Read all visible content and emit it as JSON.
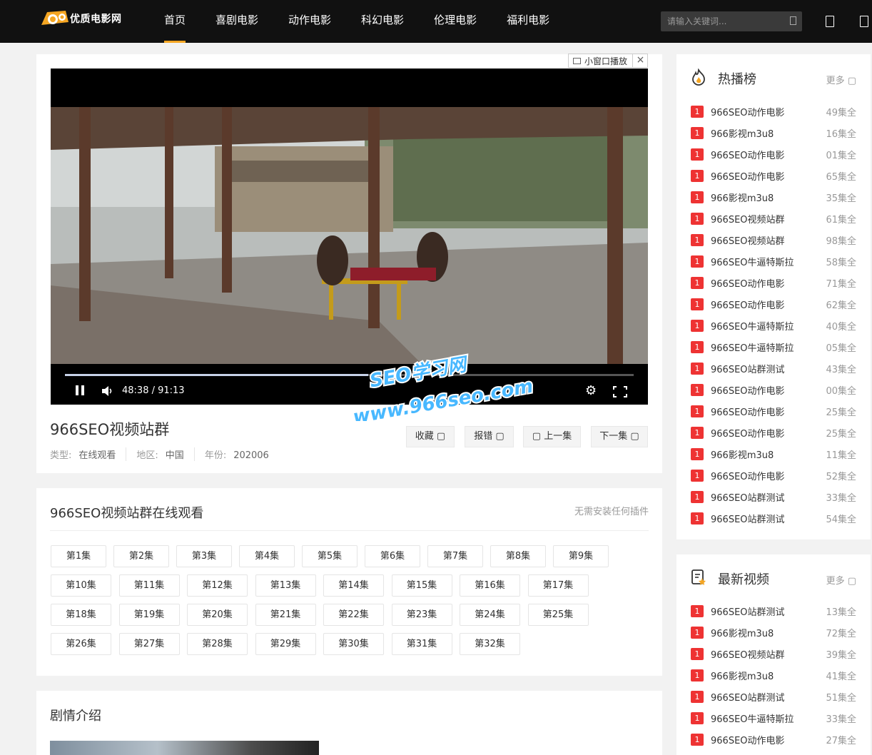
{
  "header": {
    "logo_text": "优质电影网",
    "nav": [
      "首页",
      "喜剧电影",
      "动作电影",
      "科幻电影",
      "伦理电影",
      "福利电影"
    ],
    "search_placeholder": "请输入关键词...",
    "accent": "#f5a623"
  },
  "player": {
    "mini_window_label": "小窗口播放",
    "close_symbol": "×",
    "time": "48:38 / 91:13",
    "progress": 0.533,
    "watermark_line1": "SEO学习网",
    "watermark_line2": "www.966seo.com"
  },
  "video_info": {
    "title": "966SEO视频站群",
    "type_label": "类型:",
    "type_value": "在线观看",
    "region_label": "地区:",
    "region_value": "中国",
    "year_label": "年份:",
    "year_value": "202006",
    "actions": [
      "收藏 ▢",
      "报错 ▢",
      "▢ 上一集",
      "下一集 ▢"
    ]
  },
  "episodes": {
    "title": "966SEO视频站群在线观看",
    "note": "无需安装任何插件",
    "items": [
      "第1集",
      "第2集",
      "第3集",
      "第4集",
      "第5集",
      "第6集",
      "第7集",
      "第8集",
      "第9集",
      "第10集",
      "第11集",
      "第12集",
      "第13集",
      "第14集",
      "第15集",
      "第16集",
      "第17集",
      "第18集",
      "第19集",
      "第20集",
      "第21集",
      "第22集",
      "第23集",
      "第24集",
      "第25集",
      "第26集",
      "第27集",
      "第28集",
      "第29集",
      "第30集",
      "第31集",
      "第32集"
    ]
  },
  "plot": {
    "title": "剧情介绍"
  },
  "hot": {
    "title": "热播榜",
    "more": "更多 ▢",
    "items": [
      {
        "num": "1",
        "name": "966SEO动作电影",
        "eps": "49集全"
      },
      {
        "num": "1",
        "name": "966影视m3u8",
        "eps": "16集全"
      },
      {
        "num": "1",
        "name": "966SEO动作电影",
        "eps": "01集全"
      },
      {
        "num": "1",
        "name": "966SEO动作电影",
        "eps": "65集全"
      },
      {
        "num": "1",
        "name": "966影视m3u8",
        "eps": "35集全"
      },
      {
        "num": "1",
        "name": "966SEO视频站群",
        "eps": "61集全"
      },
      {
        "num": "1",
        "name": "966SEO视频站群",
        "eps": "98集全"
      },
      {
        "num": "1",
        "name": "966SEO牛逼特斯拉",
        "eps": "58集全"
      },
      {
        "num": "1",
        "name": "966SEO动作电影",
        "eps": "71集全"
      },
      {
        "num": "1",
        "name": "966SEO动作电影",
        "eps": "62集全"
      },
      {
        "num": "1",
        "name": "966SEO牛逼特斯拉",
        "eps": "40集全"
      },
      {
        "num": "1",
        "name": "966SEO牛逼特斯拉",
        "eps": "05集全"
      },
      {
        "num": "1",
        "name": "966SEO站群测试",
        "eps": "43集全"
      },
      {
        "num": "1",
        "name": "966SEO动作电影",
        "eps": "00集全"
      },
      {
        "num": "1",
        "name": "966SEO动作电影",
        "eps": "25集全"
      },
      {
        "num": "1",
        "name": "966SEO动作电影",
        "eps": "25集全"
      },
      {
        "num": "1",
        "name": "966影视m3u8",
        "eps": "11集全"
      },
      {
        "num": "1",
        "name": "966SEO动作电影",
        "eps": "52集全"
      },
      {
        "num": "1",
        "name": "966SEO站群测试",
        "eps": "33集全"
      },
      {
        "num": "1",
        "name": "966SEO站群测试",
        "eps": "54集全"
      }
    ]
  },
  "latest": {
    "title": "最新视频",
    "more": "更多 ▢",
    "items": [
      {
        "num": "1",
        "name": "966SEO站群测试",
        "eps": "13集全"
      },
      {
        "num": "1",
        "name": "966影视m3u8",
        "eps": "72集全"
      },
      {
        "num": "1",
        "name": "966SEO视频站群",
        "eps": "39集全"
      },
      {
        "num": "1",
        "name": "966影视m3u8",
        "eps": "41集全"
      },
      {
        "num": "1",
        "name": "966SEO站群测试",
        "eps": "51集全"
      },
      {
        "num": "1",
        "name": "966SEO牛逼特斯拉",
        "eps": "33集全"
      },
      {
        "num": "1",
        "name": "966SEO动作电影",
        "eps": "27集全"
      }
    ]
  }
}
